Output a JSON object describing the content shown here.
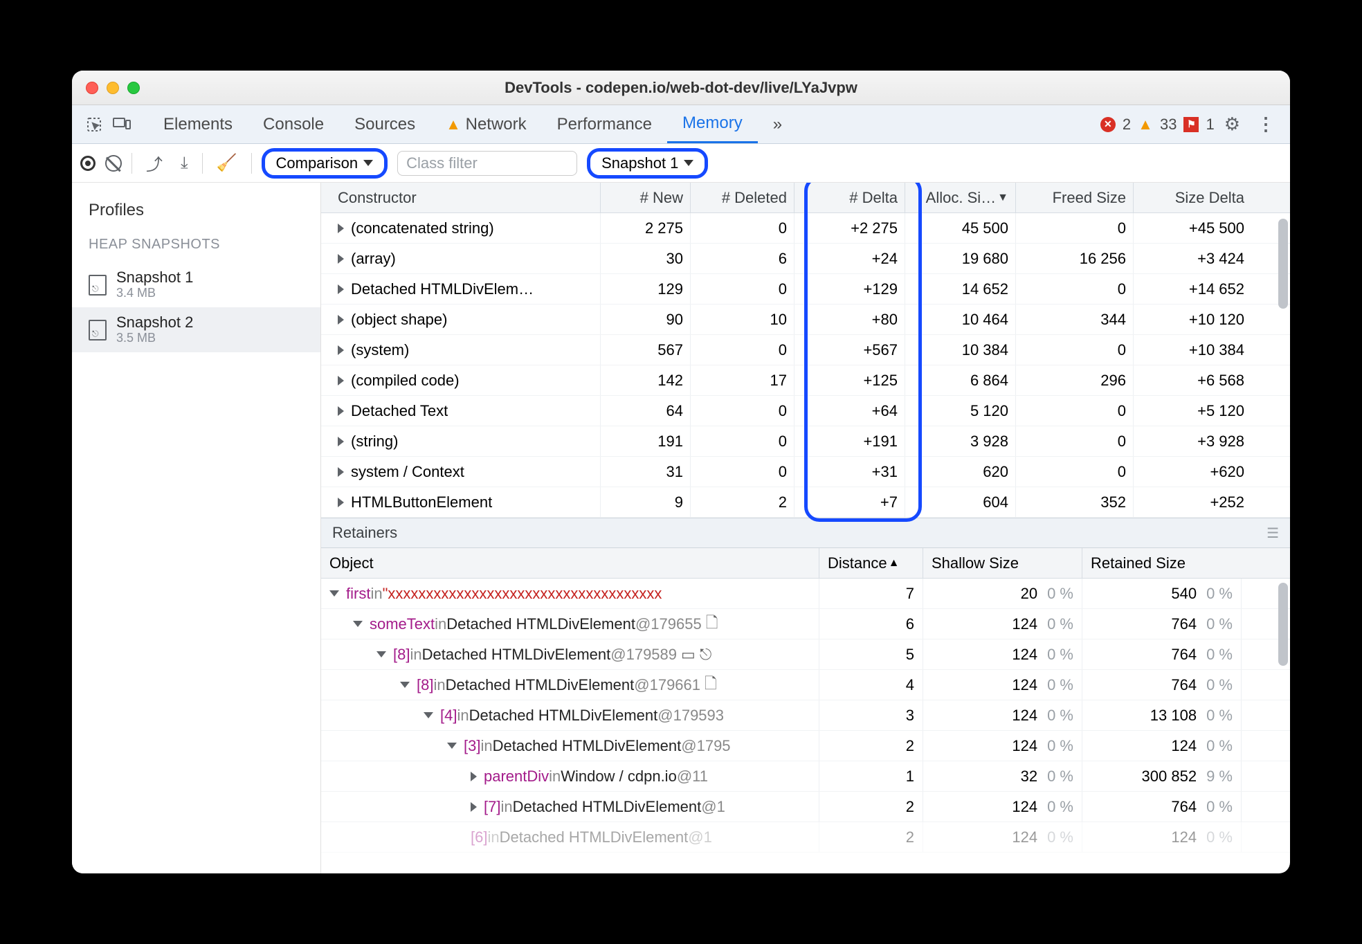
{
  "window_title": "DevTools - codepen.io/web-dot-dev/live/LYaJvpw",
  "panels": {
    "elements": "Elements",
    "console": "Console",
    "sources": "Sources",
    "network": "Network",
    "performance": "Performance",
    "memory": "Memory",
    "more": "»"
  },
  "status": {
    "errors": "2",
    "warnings": "33",
    "other": "1"
  },
  "toolbar": {
    "view_select": "Comparison",
    "filter_placeholder": "Class filter",
    "base_select": "Snapshot 1"
  },
  "sidebar": {
    "header": "Profiles",
    "section": "HEAP SNAPSHOTS",
    "snaps": [
      {
        "name": "Snapshot 1",
        "size": "3.4 MB"
      },
      {
        "name": "Snapshot 2",
        "size": "3.5 MB"
      }
    ]
  },
  "grid": {
    "headers": {
      "constructor": "Constructor",
      "new": "# New",
      "deleted": "# Deleted",
      "delta": "# Delta",
      "alloc": "Alloc. Si…",
      "freed": "Freed Size",
      "sizedelta": "Size Delta"
    },
    "rows": [
      {
        "c": "(concatenated string)",
        "n": "2 275",
        "d": "0",
        "dl": "+2 275",
        "a": "45 500",
        "f": "0",
        "sd": "+45 500"
      },
      {
        "c": "(array)",
        "n": "30",
        "d": "6",
        "dl": "+24",
        "a": "19 680",
        "f": "16 256",
        "sd": "+3 424"
      },
      {
        "c": "Detached HTMLDivElem…",
        "n": "129",
        "d": "0",
        "dl": "+129",
        "a": "14 652",
        "f": "0",
        "sd": "+14 652"
      },
      {
        "c": "(object shape)",
        "n": "90",
        "d": "10",
        "dl": "+80",
        "a": "10 464",
        "f": "344",
        "sd": "+10 120"
      },
      {
        "c": "(system)",
        "n": "567",
        "d": "0",
        "dl": "+567",
        "a": "10 384",
        "f": "0",
        "sd": "+10 384"
      },
      {
        "c": "(compiled code)",
        "n": "142",
        "d": "17",
        "dl": "+125",
        "a": "6 864",
        "f": "296",
        "sd": "+6 568"
      },
      {
        "c": "Detached Text",
        "n": "64",
        "d": "0",
        "dl": "+64",
        "a": "5 120",
        "f": "0",
        "sd": "+5 120"
      },
      {
        "c": "(string)",
        "n": "191",
        "d": "0",
        "dl": "+191",
        "a": "3 928",
        "f": "0",
        "sd": "+3 928"
      },
      {
        "c": "system / Context",
        "n": "31",
        "d": "0",
        "dl": "+31",
        "a": "620",
        "f": "0",
        "sd": "+620"
      },
      {
        "c": "HTMLButtonElement",
        "n": "9",
        "d": "2",
        "dl": "+7",
        "a": "604",
        "f": "352",
        "sd": "+252"
      }
    ]
  },
  "retainers": {
    "title": "Retainers",
    "headers": {
      "object": "Object",
      "distance": "Distance",
      "shallow": "Shallow Size",
      "retained": "Retained Size"
    },
    "rows": [
      {
        "indent": 0,
        "open": true,
        "prop": "first",
        "in": "in",
        "cls": "",
        "id": "",
        "str": "\"xxxxxxxxxxxxxxxxxxxxxxxxxxxxxxxxxxxx",
        "dist": "7",
        "sh": "20",
        "shp": "0 %",
        "re": "540",
        "rep": "0 %"
      },
      {
        "indent": 1,
        "open": true,
        "prop": "someText",
        "in": "in",
        "cls": "Detached HTMLDivElement",
        "id": "@179655",
        "badge": "🗋",
        "dist": "6",
        "sh": "124",
        "shp": "0 %",
        "re": "764",
        "rep": "0 %"
      },
      {
        "indent": 2,
        "open": true,
        "prop": "[8]",
        "in": "in",
        "cls": "Detached HTMLDivElement",
        "id": "@179589",
        "badge": "▭ ⎋",
        "dist": "5",
        "sh": "124",
        "shp": "0 %",
        "re": "764",
        "rep": "0 %"
      },
      {
        "indent": 3,
        "open": true,
        "prop": "[8]",
        "in": "in",
        "cls": "Detached HTMLDivElement",
        "id": "@179661",
        "badge": "🗋",
        "dist": "4",
        "sh": "124",
        "shp": "0 %",
        "re": "764",
        "rep": "0 %"
      },
      {
        "indent": 4,
        "open": true,
        "prop": "[4]",
        "in": "in",
        "cls": "Detached HTMLDivElement",
        "id": "@179593",
        "dist": "3",
        "sh": "124",
        "shp": "0 %",
        "re": "13 108",
        "rep": "0 %"
      },
      {
        "indent": 5,
        "open": true,
        "prop": "[3]",
        "in": "in",
        "cls": "Detached HTMLDivElement",
        "id": "@1795",
        "dist": "2",
        "sh": "124",
        "shp": "0 %",
        "re": "124",
        "rep": "0 %"
      },
      {
        "indent": 6,
        "open": false,
        "prop": "parentDiv",
        "in": "in",
        "cls": "Window / cdpn.io",
        "id": "@11",
        "dist": "1",
        "sh": "32",
        "shp": "0 %",
        "re": "300 852",
        "rep": "9 %"
      },
      {
        "indent": 6,
        "open": false,
        "prop": "[7]",
        "in": "in",
        "cls": "Detached HTMLDivElement",
        "id": "@1",
        "dist": "2",
        "sh": "124",
        "shp": "0 %",
        "re": "764",
        "rep": "0 %"
      },
      {
        "indent": 6,
        "open": null,
        "prop": "[6]",
        "in": "in",
        "cls": "Detached HTMLDivElement",
        "id": "@1",
        "ghost": true,
        "dist": "2",
        "sh": "124",
        "shp": "0 %",
        "re": "124",
        "rep": "0 %"
      }
    ]
  }
}
